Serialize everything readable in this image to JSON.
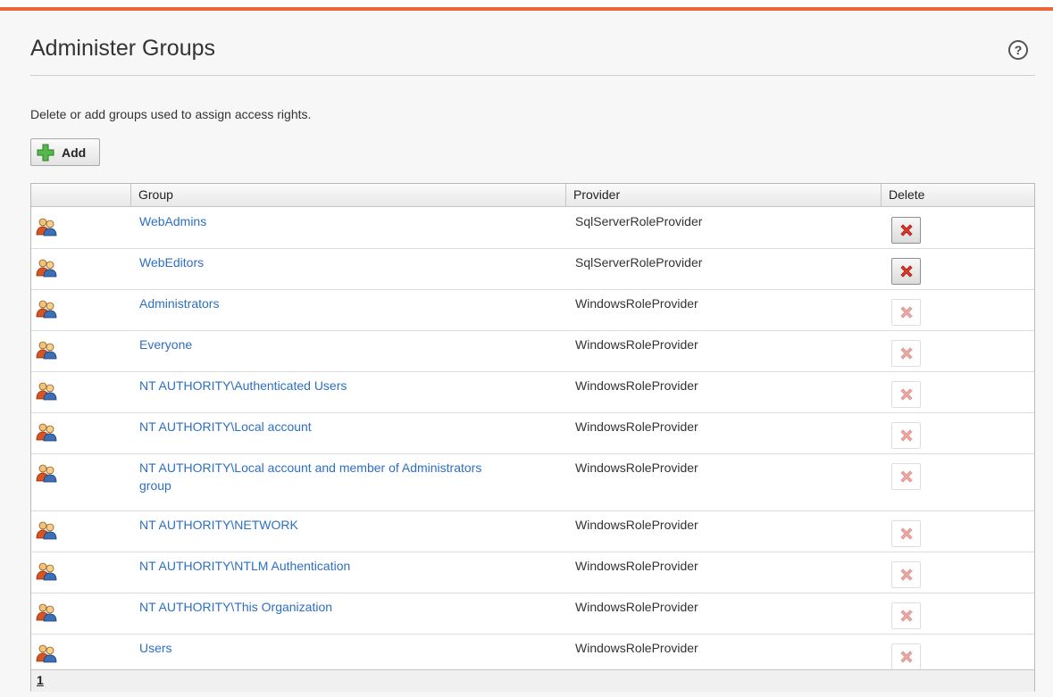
{
  "page": {
    "title": "Administer Groups",
    "description": "Delete or add groups used to assign access rights.",
    "add_label": "Add"
  },
  "table": {
    "columns": [
      "",
      "Group",
      "Provider",
      "Delete"
    ],
    "rows": [
      {
        "group": "WebAdmins",
        "provider": "SqlServerRoleProvider",
        "delete_enabled": true
      },
      {
        "group": "WebEditors",
        "provider": "SqlServerRoleProvider",
        "delete_enabled": true
      },
      {
        "group": "Administrators",
        "provider": "WindowsRoleProvider",
        "delete_enabled": false
      },
      {
        "group": "Everyone",
        "provider": "WindowsRoleProvider",
        "delete_enabled": false
      },
      {
        "group": "NT AUTHORITY\\Authenticated Users",
        "provider": "WindowsRoleProvider",
        "delete_enabled": false
      },
      {
        "group": "NT AUTHORITY\\Local account",
        "provider": "WindowsRoleProvider",
        "delete_enabled": false
      },
      {
        "group": "NT AUTHORITY\\Local account and member of Administrators group",
        "provider": "WindowsRoleProvider",
        "delete_enabled": false
      },
      {
        "group": "NT AUTHORITY\\NETWORK",
        "provider": "WindowsRoleProvider",
        "delete_enabled": false
      },
      {
        "group": "NT AUTHORITY\\NTLM Authentication",
        "provider": "WindowsRoleProvider",
        "delete_enabled": false
      },
      {
        "group": "NT AUTHORITY\\This Organization",
        "provider": "WindowsRoleProvider",
        "delete_enabled": false
      },
      {
        "group": "Users",
        "provider": "WindowsRoleProvider",
        "delete_enabled": false
      }
    ]
  },
  "pager": {
    "current_page": "1"
  },
  "colors": {
    "accent": "#e8663a",
    "link": "#2d6fc2",
    "delete_red": "#e0392b"
  },
  "icons": {
    "help": "help-icon",
    "add": "plus-icon",
    "group": "group-icon",
    "delete": "delete-x-icon"
  }
}
